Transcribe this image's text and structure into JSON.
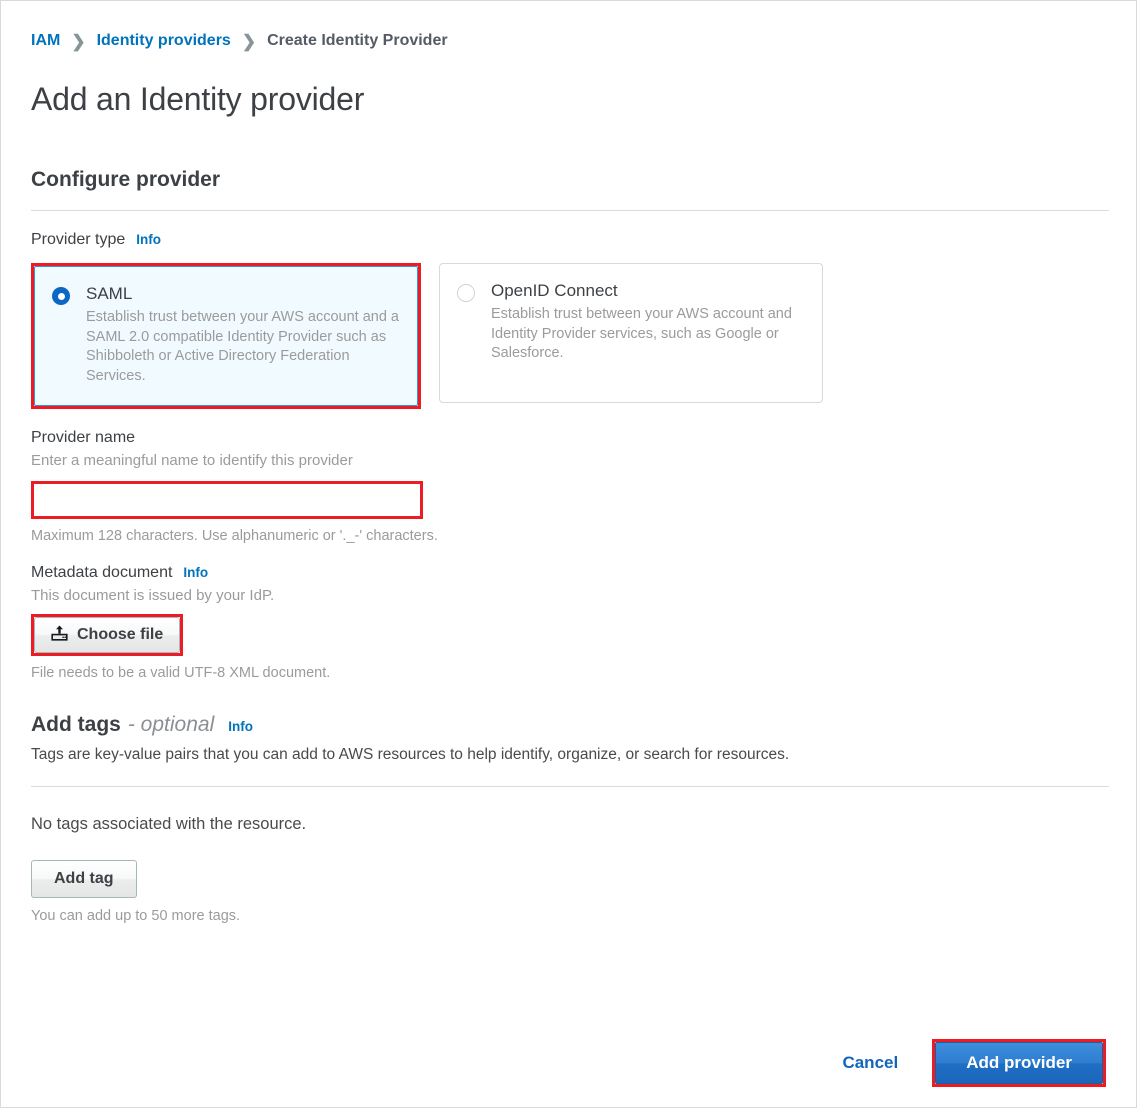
{
  "breadcrumb": {
    "items": [
      {
        "label": "IAM",
        "type": "link"
      },
      {
        "label": "Identity providers",
        "type": "link"
      },
      {
        "label": "Create Identity Provider",
        "type": "current"
      }
    ],
    "separator": "❯"
  },
  "page": {
    "title": "Add an Identity provider",
    "section_title": "Configure provider"
  },
  "provider_type": {
    "label": "Provider type",
    "info_label": "Info",
    "options": [
      {
        "id": "saml",
        "title": "SAML",
        "description": "Establish trust between your AWS account and a SAML 2.0 compatible Identity Provider such as Shibboleth or Active Directory Federation Services.",
        "selected": true
      },
      {
        "id": "openid-connect",
        "title": "OpenID Connect",
        "description": "Establish trust between your AWS account and Identity Provider services, such as Google or Salesforce.",
        "selected": false
      }
    ]
  },
  "provider_name": {
    "label": "Provider name",
    "description": "Enter a meaningful name to identify this provider",
    "value": "",
    "placeholder": "",
    "constraint": "Maximum 128 characters. Use alphanumeric or '._-' characters."
  },
  "metadata_document": {
    "label": "Metadata document",
    "info_label": "Info",
    "description": "This document is issued by your IdP.",
    "choose_file_label": "Choose file",
    "file_hint": "File needs to be a valid UTF-8 XML document."
  },
  "add_tags": {
    "title": "Add tags",
    "optional_label": "- optional",
    "info_label": "Info",
    "description": "Tags are key-value pairs that you can add to AWS resources to help identify, organize, or search for resources.",
    "empty_state": "No tags associated with the resource.",
    "add_tag_label": "Add tag",
    "limit_note": "You can add up to 50 more tags."
  },
  "footer": {
    "cancel_label": "Cancel",
    "submit_label": "Add provider"
  },
  "colors": {
    "link": "#0073bb",
    "annotation": "#ed1c24",
    "selected_card_bg": "#f1faff",
    "selected_radio": "#0a68c4",
    "primary_button": "#2e7dd0"
  }
}
